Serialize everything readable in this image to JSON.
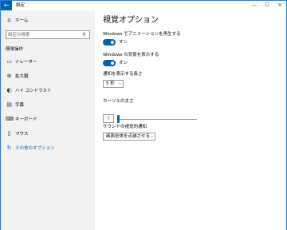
{
  "window": {
    "title": "設定",
    "back_glyph": "←",
    "minimize_glyph": "—",
    "maximize_glyph": "☐",
    "close_glyph": "✕"
  },
  "sidebar": {
    "home": {
      "label": "ホーム",
      "icon": "home-icon",
      "glyph": "⌂"
    },
    "search": {
      "placeholder": "設定の検索",
      "icon": "search-icon",
      "glyph": "⚲"
    },
    "section_header": "簡単操作",
    "items": [
      {
        "label": "ナレーター",
        "icon": "narrator-icon",
        "glyph": "▭"
      },
      {
        "label": "拡大鏡",
        "icon": "magnifier-icon",
        "glyph": "⊕"
      },
      {
        "label": "ハイ コントラスト",
        "icon": "high-contrast-icon",
        "glyph": "◐"
      },
      {
        "label": "字幕",
        "icon": "closed-captions-icon",
        "glyph": "▤"
      },
      {
        "label": "キーボード",
        "icon": "keyboard-icon",
        "glyph": "⌨"
      },
      {
        "label": "マウス",
        "icon": "mouse-icon",
        "glyph": "▯"
      },
      {
        "label": "その他のオプション",
        "icon": "other-options-icon",
        "glyph": "↻",
        "selected": true
      }
    ]
  },
  "main": {
    "title": "視覚オプション",
    "animations": {
      "label": "Windows でアニメーションを再生する",
      "state": "オン",
      "on": true
    },
    "background": {
      "label": "Windows の背景を表示する",
      "state": "オン",
      "on": true
    },
    "notification_duration": {
      "label": "通知を表示する長さ",
      "value": "5 秒",
      "chevron": "⌵"
    },
    "cursor_thickness": {
      "label": "カーソルの太さ",
      "value": "|",
      "level": 0.02
    },
    "sound_notification": {
      "label": "サウンドの視覚的通知",
      "value": "画面全体を点滅させる",
      "chevron": "⌵"
    }
  },
  "colors": {
    "accent": "#0063b1",
    "sidebar_bg": "#f2f2f2"
  }
}
